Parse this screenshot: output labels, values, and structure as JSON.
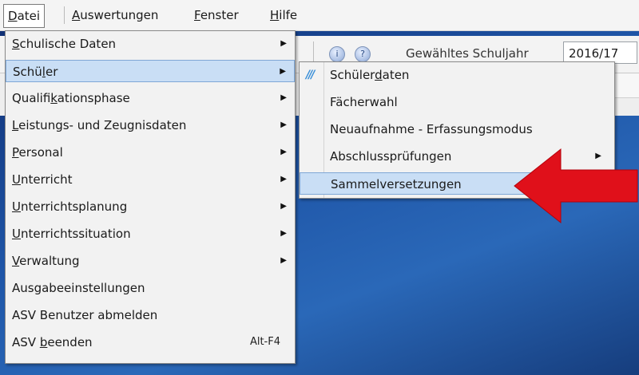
{
  "menubar": {
    "items": [
      {
        "pre": "",
        "acc": "D",
        "post": "atei"
      },
      {
        "pre": "",
        "acc": "A",
        "post": "uswertungen"
      },
      {
        "pre": "",
        "acc": "F",
        "post": "enster"
      },
      {
        "pre": "",
        "acc": "H",
        "post": "ilfe"
      }
    ]
  },
  "toolbar": {
    "year_label": "Gewähltes Schuljahr",
    "year_value": "2016/17"
  },
  "main_menu": {
    "items": [
      {
        "pre": "",
        "acc": "S",
        "post": "chulische Daten",
        "arrow": "▶"
      },
      {
        "pre": "Schü",
        "acc": "l",
        "post": "er",
        "arrow": "▶"
      },
      {
        "pre": "Qualifi",
        "acc": "k",
        "post": "ationsphase",
        "arrow": "▶"
      },
      {
        "pre": "",
        "acc": "L",
        "post": "eistungs- und Zeugnisdaten",
        "arrow": "▶"
      },
      {
        "pre": "",
        "acc": "P",
        "post": "ersonal",
        "arrow": "▶"
      },
      {
        "pre": "",
        "acc": "U",
        "post": "nterricht",
        "arrow": "▶"
      },
      {
        "pre": "",
        "acc": "U",
        "post": "nterrichtsplanung",
        "arrow": "▶"
      },
      {
        "pre": "",
        "acc": "U",
        "post": "nterrichtssituation",
        "arrow": "▶"
      },
      {
        "pre": "",
        "acc": "V",
        "post": "erwaltung",
        "arrow": "▶"
      },
      {
        "pre": "Ausgabeeinstellungen",
        "acc": "",
        "post": ""
      },
      {
        "pre": "ASV Benutzer abmelden",
        "acc": "",
        "post": ""
      },
      {
        "pre": "ASV ",
        "acc": "b",
        "post": "eenden",
        "accel": "Alt-F4"
      }
    ]
  },
  "sub_menu": {
    "items": [
      {
        "pre": "Schüler",
        "acc": "d",
        "post": "aten",
        "icon": "///"
      },
      {
        "pre": "Fächerwahl",
        "acc": "",
        "post": ""
      },
      {
        "pre": "Neuaufnahme - Erfassungsmodus",
        "acc": "",
        "post": ""
      },
      {
        "pre": "Abschlussprüfungen",
        "acc": "",
        "post": "",
        "arrow": "▶"
      },
      {
        "pre": "Sammelversetzungen",
        "acc": "",
        "post": ""
      }
    ]
  },
  "colors": {
    "highlight": "#c9def5",
    "annotation_arrow": "#e0101a"
  },
  "icons": {
    "submenu_arrow": "chevron-right-icon",
    "schuelerdaten": "students-icon",
    "annotation": "red-arrow-icon",
    "toolbar_buttons": [
      "info-icon",
      "help-icon"
    ]
  }
}
